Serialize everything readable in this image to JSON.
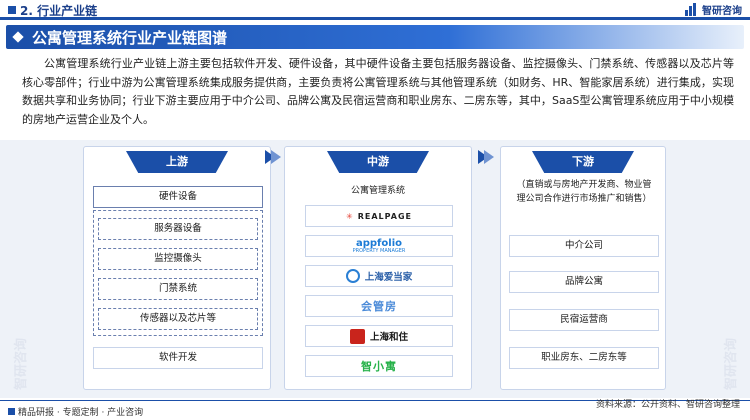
{
  "header": {
    "section": "2. 行业产业链",
    "brand": "智研咨询"
  },
  "banner": {
    "title": "公寓管理系统行业产业链图谱"
  },
  "intro": "公寓管理系统行业产业链上游主要包括软件开发、硬件设备，其中硬件设备主要包括服务器设备、监控摄像头、门禁系统、传感器以及芯片等核心零部件；行业中游为公寓管理系统集成服务提供商，主要负责将公寓管理系统与其他管理系统（如财务、HR、智能家居系统）进行集成，实现数据共享和业务协同；行业下游主要应用于中介公司、品牌公寓及民宿运营商和职业房东、二房东等，其中，SaaS型公寓管理系统应用于中小规模的房地产运营企业及个人。",
  "upstream": {
    "title": "上游",
    "hardware": "硬件设备",
    "items": [
      "服务器设备",
      "监控摄像头",
      "门禁系统",
      "传感器以及芯片等"
    ],
    "software": "软件开发"
  },
  "midstream": {
    "title": "中游",
    "label": "公寓管理系统",
    "companies": {
      "realpage": "REALPAGE",
      "appfolio": "appfolio",
      "appfolio_sub": "PROPERTY MANAGER",
      "aidangjia": "上海爱当家",
      "huiguan": "会管房",
      "hezhu": "上海和住",
      "zhixiaoyu": "智小寓"
    }
  },
  "downstream": {
    "title": "下游",
    "note": "（直销或与房地产开发商、物业管理公司合作进行市场推广和销售）",
    "items": [
      "中介公司",
      "品牌公寓",
      "民宿运营商",
      "职业房东、二房东等"
    ]
  },
  "watermark": "智研咨询",
  "footer": {
    "left": "精品研报 · 专题定制 · 产业咨询",
    "right": "资料来源：公开资料、智研咨询整理"
  },
  "colors": {
    "primary": "#1b4fa8",
    "panel_bg": "#eef2f8",
    "border": "#c8d4ea"
  }
}
